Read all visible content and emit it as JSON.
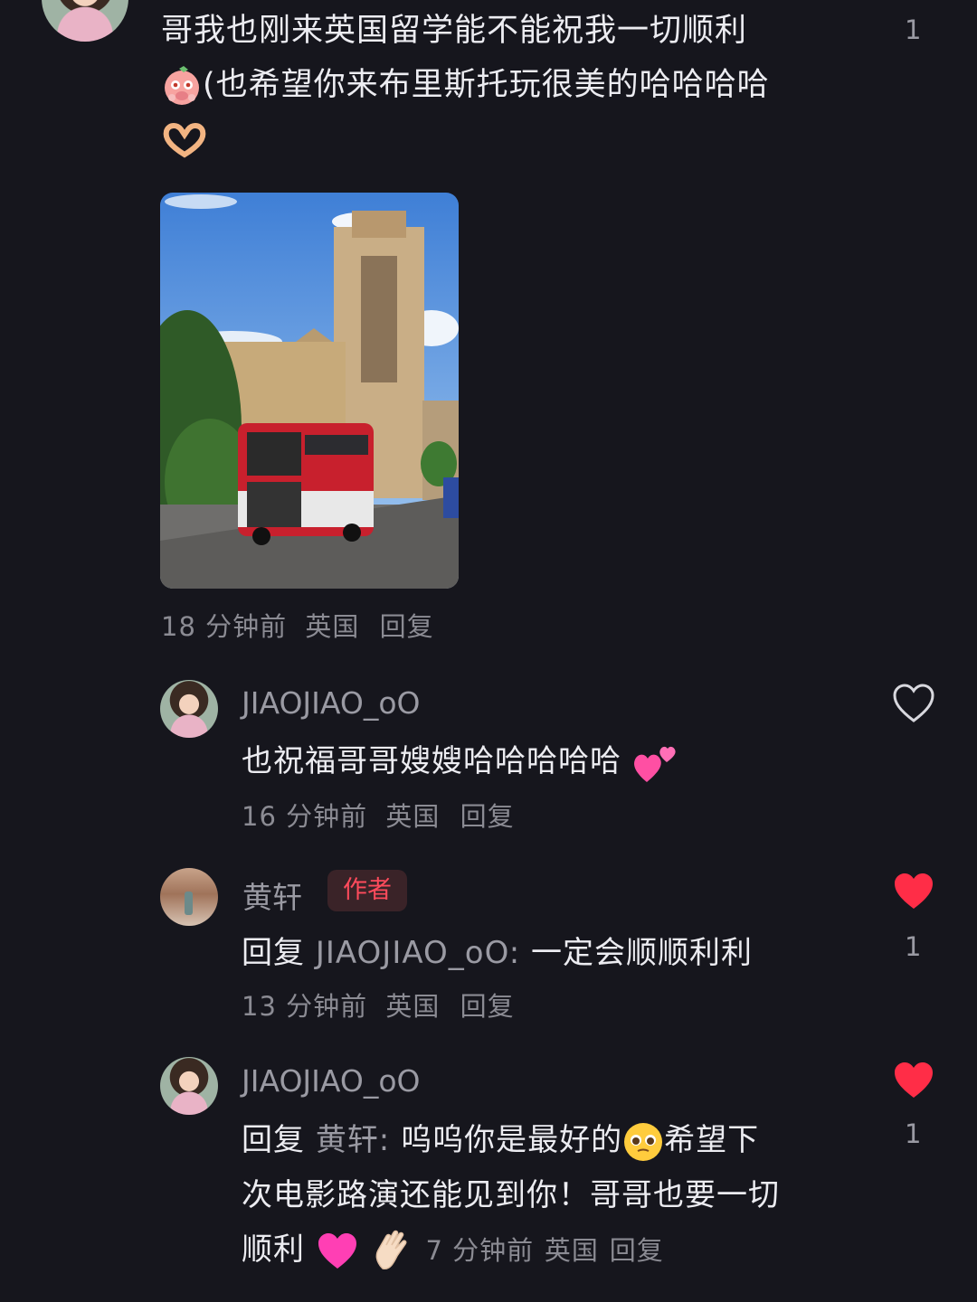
{
  "parent_comment": {
    "line1": "哥我也刚来英国留学能不能祝我一切顺利",
    "line2": "(也希望你来布里斯托玩很美的哈哈哈哈",
    "like_count": "1",
    "time": "18 分钟前",
    "region": "英国",
    "reply_label": "回复"
  },
  "replies": [
    {
      "username": "JIAOJIAO_oO",
      "text": "也祝福哥哥嫂嫂哈哈哈哈哈",
      "time": "16 分钟前",
      "region": "英国",
      "reply_label": "回复"
    },
    {
      "username": "黄轩",
      "badge": "作者",
      "reply_prefix": "回复",
      "mention": "JIAOJIAO_oO:",
      "text": "一定会顺顺利利",
      "like_count": "1",
      "time": "13 分钟前",
      "region": "英国",
      "reply_label": "回复"
    },
    {
      "username": "JIAOJIAO_oO",
      "reply_prefix": "回复",
      "mention": "黄轩:",
      "text_a": "呜呜你是最好的",
      "text_b": "希望下",
      "line2": "次电影路演还能见到你！哥哥也要一切",
      "line3": "顺利",
      "like_count": "1",
      "time": "7 分钟前",
      "region": "英国",
      "reply_label": "回复"
    }
  ],
  "colors": {
    "background": "#16161d",
    "liked_heart": "#ff2d47",
    "author_badge": "#ff4b5c"
  },
  "icons": [
    "heart-outline-icon",
    "heart-filled-icon",
    "pig-face-emoji",
    "heart-hands-emoji",
    "two-hearts-emoji",
    "pleading-face-emoji",
    "pink-heart-emoji",
    "waving-hand-emoji"
  ]
}
